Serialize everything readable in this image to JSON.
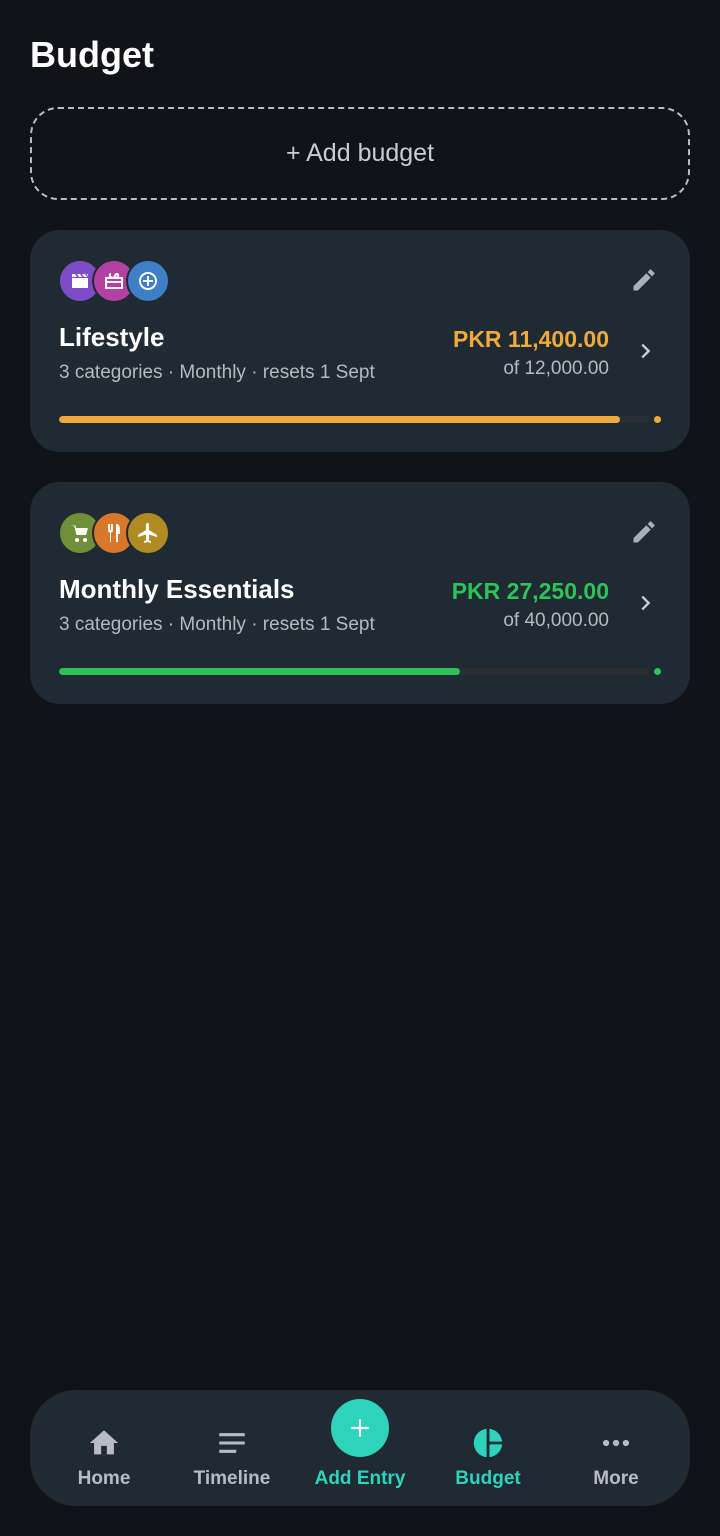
{
  "page": {
    "title": "Budget"
  },
  "add_budget": {
    "label": "+ Add budget"
  },
  "budgets": [
    {
      "name": "Lifestyle",
      "subtitle": "3 categories · Monthly · resets 1 Sept",
      "spent": "PKR 11,400.00",
      "total": "of 12,000.00",
      "progress": 0.95,
      "accent": "#f0a93b",
      "icons": [
        {
          "name": "movie-icon",
          "color": "#7e4cc6"
        },
        {
          "name": "gift-icon",
          "color": "#b340a2"
        },
        {
          "name": "gamepad-icon",
          "color": "#3f7fc8"
        }
      ]
    },
    {
      "name": "Monthly Essentials",
      "subtitle": "3 categories · Monthly · resets 1 Sept",
      "spent": "PKR 27,250.00",
      "total": "of 40,000.00",
      "progress": 0.68,
      "accent": "#2cc35a",
      "icons": [
        {
          "name": "cart-icon",
          "color": "#6f8f3a"
        },
        {
          "name": "restaurant-icon",
          "color": "#d8772a"
        },
        {
          "name": "airplane-icon",
          "color": "#b08a22"
        }
      ]
    }
  ],
  "nav": {
    "items": [
      {
        "label": "Home",
        "icon": "home-icon"
      },
      {
        "label": "Timeline",
        "icon": "timeline-icon"
      },
      {
        "label": "Add Entry",
        "icon": "plus-icon"
      },
      {
        "label": "Budget",
        "icon": "pie-chart-icon",
        "active": true
      },
      {
        "label": "More",
        "icon": "more-icon"
      }
    ],
    "active_color": "#2ed3bb"
  }
}
